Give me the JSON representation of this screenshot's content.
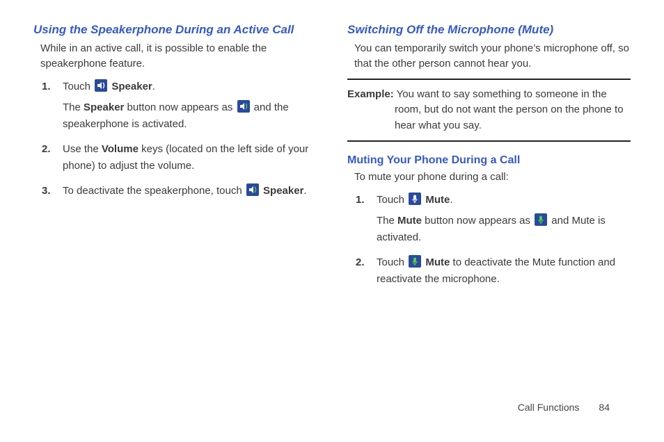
{
  "left": {
    "heading": "Using the Speakerphone During an Active Call",
    "lead": "While in an active call, it is possible to enable the speakerphone feature.",
    "steps": [
      {
        "pre": "Touch ",
        "label": "Speaker",
        "post": ".",
        "sub_pre": "The ",
        "sub_bold": "Speaker",
        "sub_mid": " button now appears as ",
        "sub_post": " and the speakerphone is activated."
      },
      {
        "text_pre": "Use the ",
        "text_bold": "Volume",
        "text_post": " keys (located on the left side of your phone) to adjust the volume."
      },
      {
        "text_pre": "To deactivate the speakerphone, touch ",
        "label": "Speaker",
        "text_post": "."
      }
    ]
  },
  "right": {
    "heading": "Switching Off the Microphone (Mute)",
    "lead": "You can temporarily switch your phone’s microphone off, so that the other person cannot hear you.",
    "example_label": "Example:",
    "example_first": " You want to say something to someone in the",
    "example_rest": "room, but do not want the person on the phone to hear what you say.",
    "subheading": "Muting Your Phone During a Call",
    "sublead": "To mute your phone during a call:",
    "steps": [
      {
        "pre": "Touch ",
        "label": "Mute",
        "post": ".",
        "sub_pre": "The ",
        "sub_bold": "Mute",
        "sub_mid": " button now appears as ",
        "sub_post": " and Mute is activated."
      },
      {
        "pre": "Touch ",
        "label": "Mute",
        "post": " to deactivate the Mute function and reactivate the microphone."
      }
    ]
  },
  "footer": {
    "section": "Call Functions",
    "page": "84"
  }
}
